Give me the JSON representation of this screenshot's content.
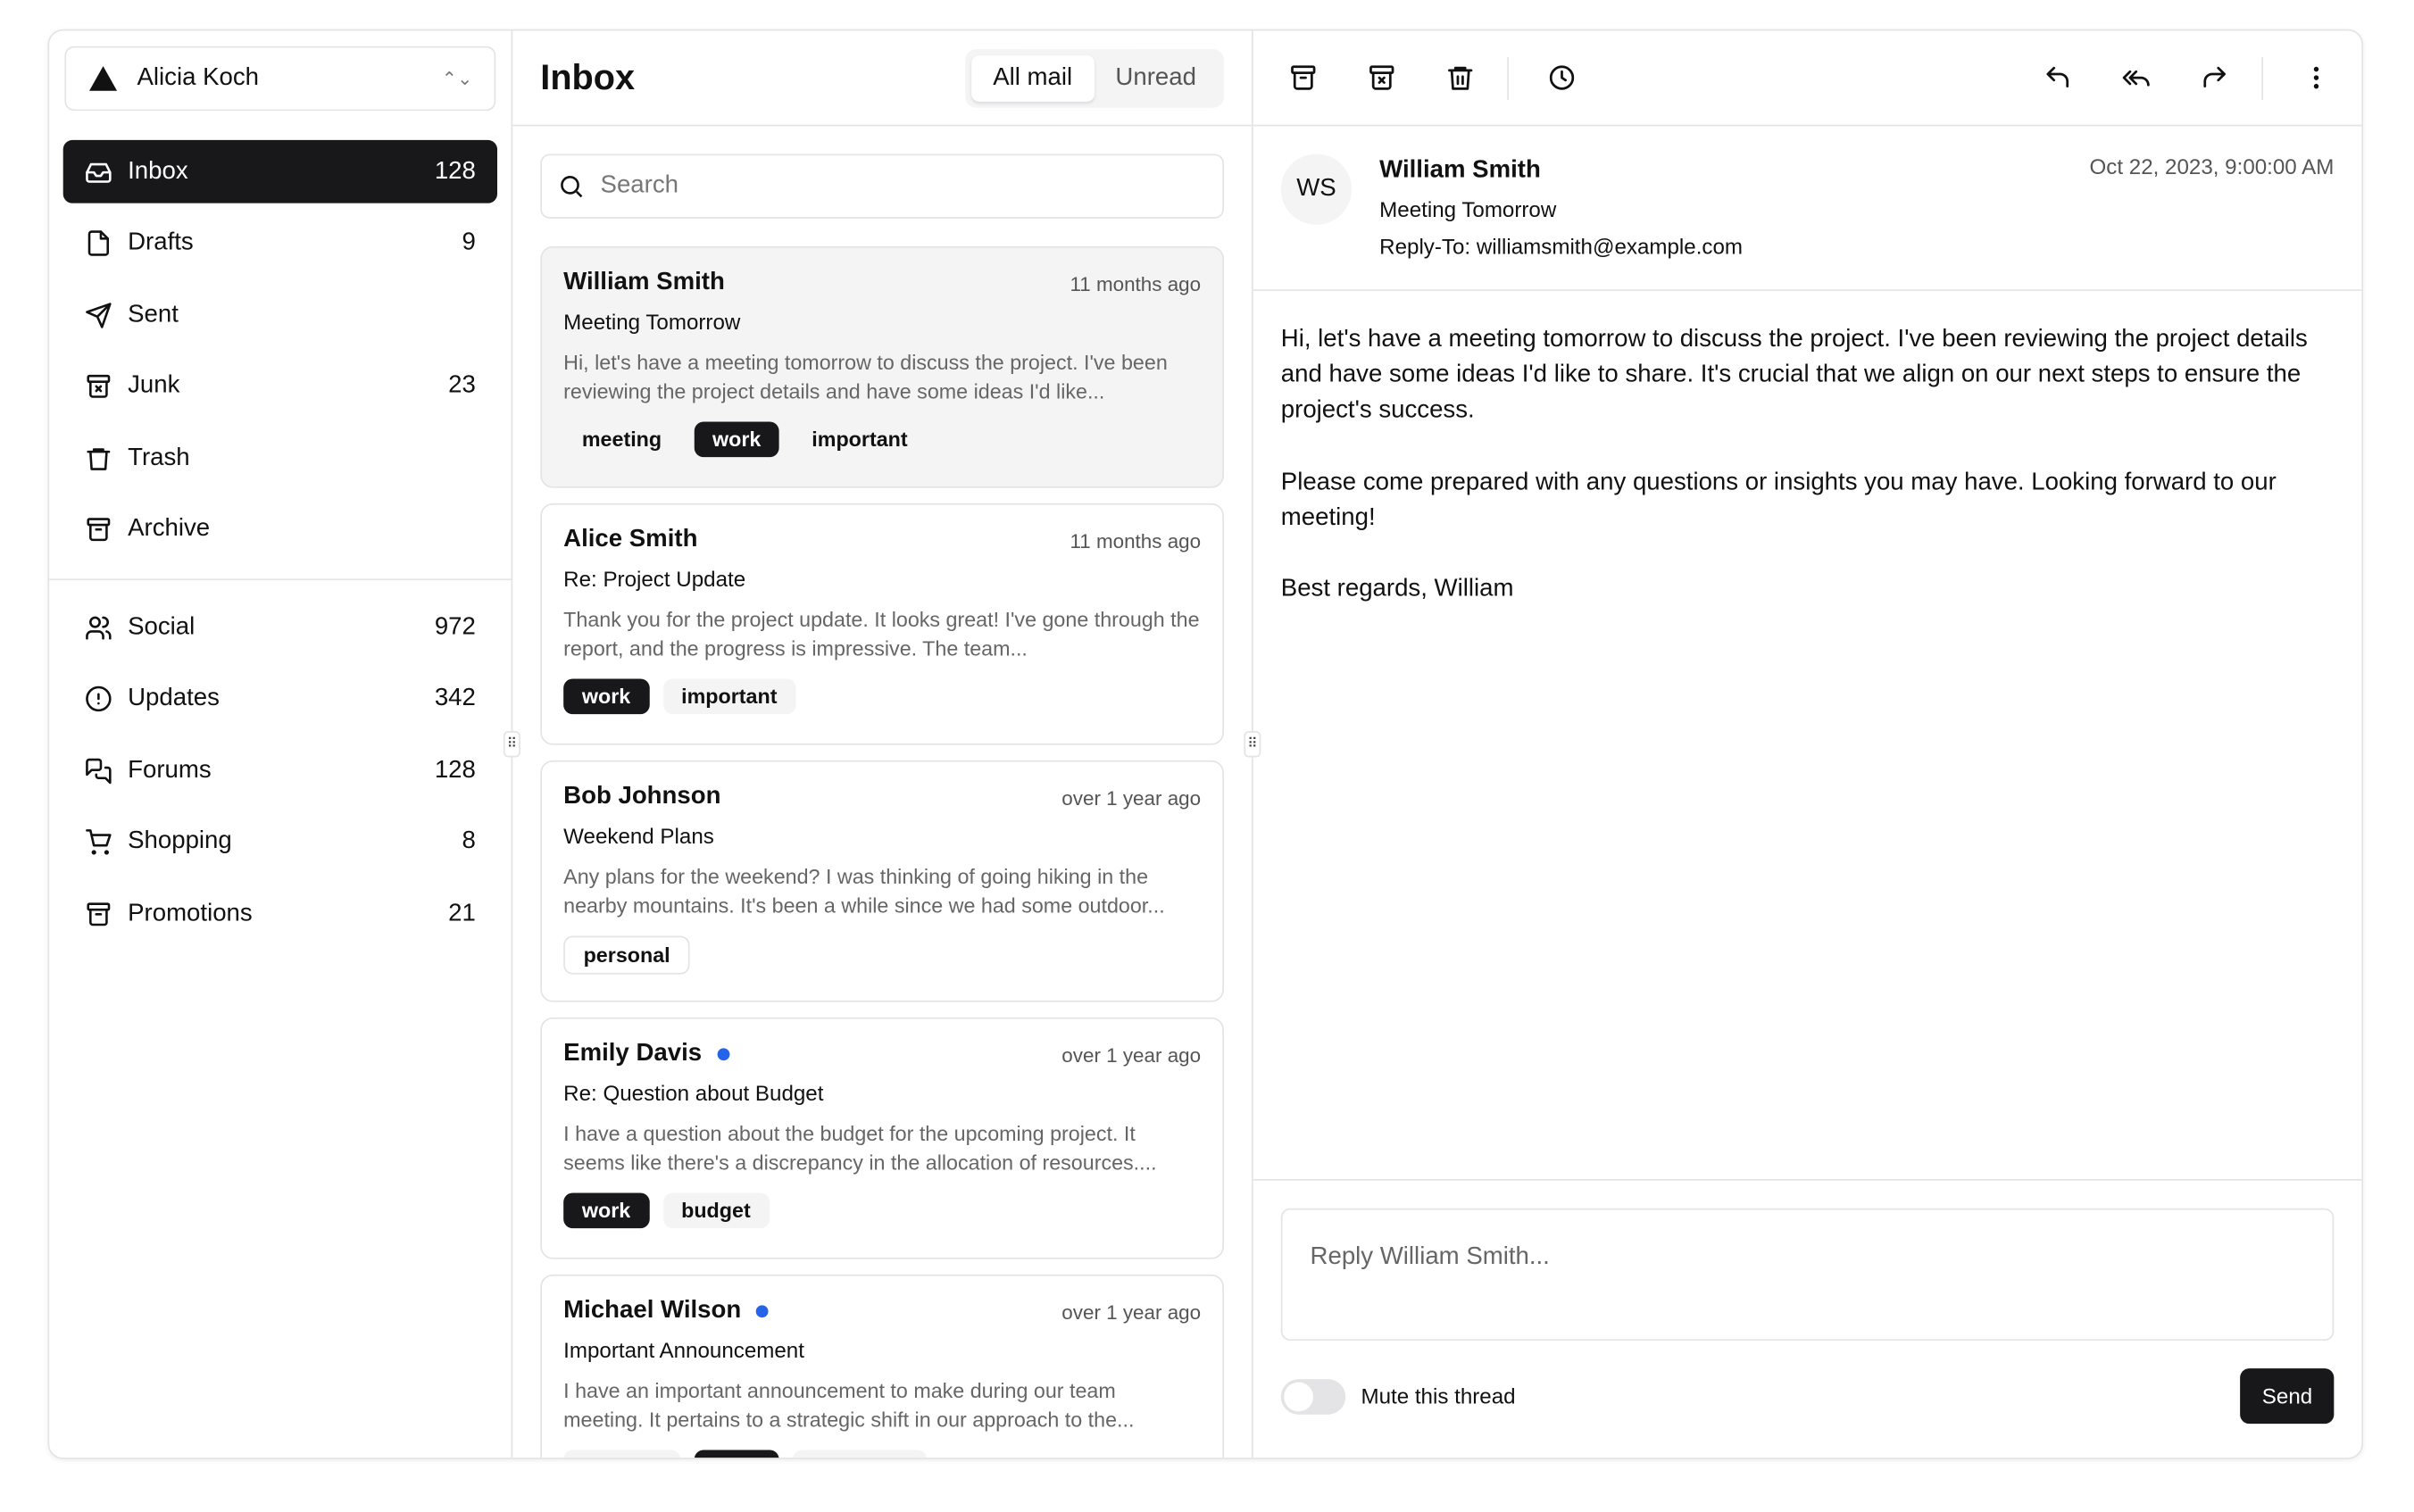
{
  "account": {
    "name": "Alicia Koch"
  },
  "nav_primary": [
    {
      "label": "Inbox",
      "count": "128",
      "icon": "inbox-icon",
      "active": true
    },
    {
      "label": "Drafts",
      "count": "9",
      "icon": "file-icon"
    },
    {
      "label": "Sent",
      "count": "",
      "icon": "send-icon"
    },
    {
      "label": "Junk",
      "count": "23",
      "icon": "archive-x-icon"
    },
    {
      "label": "Trash",
      "count": "",
      "icon": "trash-icon"
    },
    {
      "label": "Archive",
      "count": "",
      "icon": "archive-icon"
    }
  ],
  "nav_secondary": [
    {
      "label": "Social",
      "count": "972",
      "icon": "users-icon"
    },
    {
      "label": "Updates",
      "count": "342",
      "icon": "alert-circle-icon"
    },
    {
      "label": "Forums",
      "count": "128",
      "icon": "messages-icon"
    },
    {
      "label": "Shopping",
      "count": "8",
      "icon": "cart-icon"
    },
    {
      "label": "Promotions",
      "count": "21",
      "icon": "archive-icon"
    }
  ],
  "list": {
    "title": "Inbox",
    "tabs": [
      "All mail",
      "Unread"
    ],
    "search_placeholder": "Search"
  },
  "mails": [
    {
      "name": "William Smith",
      "time": "11 months ago",
      "subject": "Meeting Tomorrow",
      "preview": "Hi, let's have a meeting tomorrow to discuss the project. I've been reviewing the project details and have some ideas I'd like...",
      "tags": [
        "meeting",
        "work",
        "important"
      ],
      "unread": false,
      "selected": true
    },
    {
      "name": "Alice Smith",
      "time": "11 months ago",
      "subject": "Re: Project Update",
      "preview": "Thank you for the project update. It looks great! I've gone through the report, and the progress is impressive. The team...",
      "tags": [
        "work",
        "important"
      ],
      "unread": false
    },
    {
      "name": "Bob Johnson",
      "time": "over 1 year ago",
      "subject": "Weekend Plans",
      "preview": "Any plans for the weekend? I was thinking of going hiking in the nearby mountains. It's been a while since we had some outdoor...",
      "tags": [
        "personal"
      ],
      "unread": false
    },
    {
      "name": "Emily Davis",
      "time": "over 1 year ago",
      "subject": "Re: Question about Budget",
      "preview": "I have a question about the budget for the upcoming project. It seems like there's a discrepancy in the allocation of resources....",
      "tags": [
        "work",
        "budget"
      ],
      "unread": true
    },
    {
      "name": "Michael Wilson",
      "time": "over 1 year ago",
      "subject": "Important Announcement",
      "preview": "I have an important announcement to make during our team meeting. It pertains to a strategic shift in our approach to the...",
      "tags": [
        "meeting",
        "work",
        "important"
      ],
      "unread": true
    }
  ],
  "detail": {
    "initials": "WS",
    "name": "William Smith",
    "subject": "Meeting Tomorrow",
    "reply_to": "Reply-To: williamsmith@example.com",
    "date": "Oct 22, 2023, 9:00:00 AM",
    "body": "Hi, let's have a meeting tomorrow to discuss the project. I've been reviewing the project details and have some ideas I'd like to share. It's crucial that we align on our next steps to ensure the project's success.\n\nPlease come prepared with any questions or insights you may have. Looking forward to our meeting!\n\nBest regards, William",
    "reply_placeholder": "Reply William Smith...",
    "mute_label": "Mute this thread",
    "mute_on": false,
    "send_label": "Send"
  },
  "colors": {
    "accent": "#18181b",
    "unread_dot": "#2563eb",
    "border": "#e4e4e7"
  }
}
